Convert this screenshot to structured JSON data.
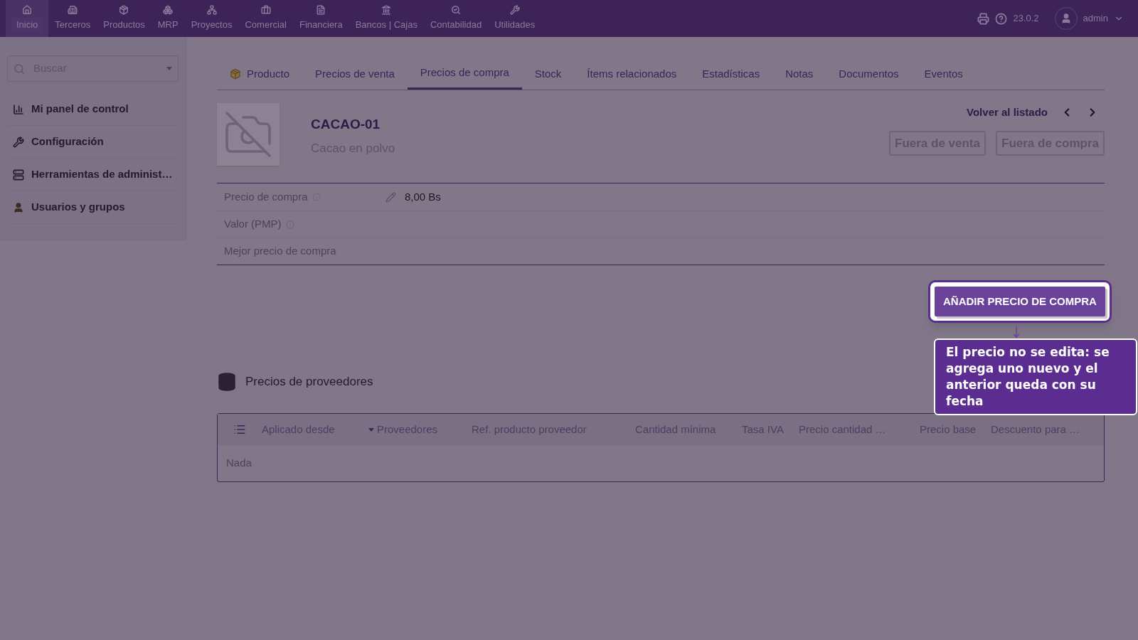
{
  "topbar": {
    "nav": [
      {
        "label": "Inicio",
        "selected": true
      },
      {
        "label": "Terceros",
        "selected": false
      },
      {
        "label": "Productos",
        "selected": false
      },
      {
        "label": "MRP",
        "selected": false
      },
      {
        "label": "Proyectos",
        "selected": false
      },
      {
        "label": "Comercial",
        "selected": false
      },
      {
        "label": "Financiera",
        "selected": false
      },
      {
        "label": "Bancos | Cajas",
        "selected": false
      },
      {
        "label": "Contabilidad",
        "selected": false
      },
      {
        "label": "Utilidades",
        "selected": false
      }
    ],
    "version": "23.0.2",
    "user": "admin"
  },
  "sidebar": {
    "search": {
      "placeholder": "Buscar"
    },
    "items": [
      "Mi panel de control",
      "Configuración",
      "Herramientas de administ…",
      "Usuarios y grupos"
    ]
  },
  "tabs": [
    {
      "label": "Producto",
      "selected": false
    },
    {
      "label": "Precios de venta",
      "selected": false
    },
    {
      "label": "Precios de compra",
      "selected": true
    },
    {
      "label": "Stock",
      "selected": false
    },
    {
      "label": "Ítems relacionados",
      "selected": false
    },
    {
      "label": "Estadísticas",
      "selected": false
    },
    {
      "label": "Notas",
      "selected": false
    },
    {
      "label": "Documentos",
      "selected": false
    },
    {
      "label": "Eventos",
      "selected": false
    }
  ],
  "product": {
    "ref": "CACAO-01",
    "label": "Cacao en polvo",
    "back_link": "Volver al listado",
    "status_badges": [
      "Fuera de venta",
      "Fuera de compra"
    ]
  },
  "fields": [
    {
      "label": "Precio de compra",
      "info": true,
      "editable": true,
      "value": "8,00 Bs"
    },
    {
      "label": "Valor (PMP)",
      "info": true,
      "editable": false
    },
    {
      "label": "Mejor precio de compra",
      "info": false,
      "editable": false
    }
  ],
  "add_button": "AÑADIR PRECIO DE COMPRA",
  "tooltip": "El precio no se edita: se agrega uno nuevo y el anterior queda con su fecha",
  "suppliers": {
    "title": "Precios de proveedores",
    "columns": [
      {
        "label": "Aplicado desde",
        "sorted": false
      },
      {
        "label": "Proveedores",
        "sorted": true
      },
      {
        "label": "Ref. producto proveedor",
        "sorted": false
      },
      {
        "label": "Cantidad mínima",
        "sorted": false
      },
      {
        "label": "Tasa IVA",
        "sorted": false
      },
      {
        "label": "Precio cantidad …",
        "sorted": false
      },
      {
        "label": "Precio base",
        "sorted": false
      },
      {
        "label": "Descuento para …",
        "sorted": false
      }
    ],
    "empty": "Nada"
  }
}
